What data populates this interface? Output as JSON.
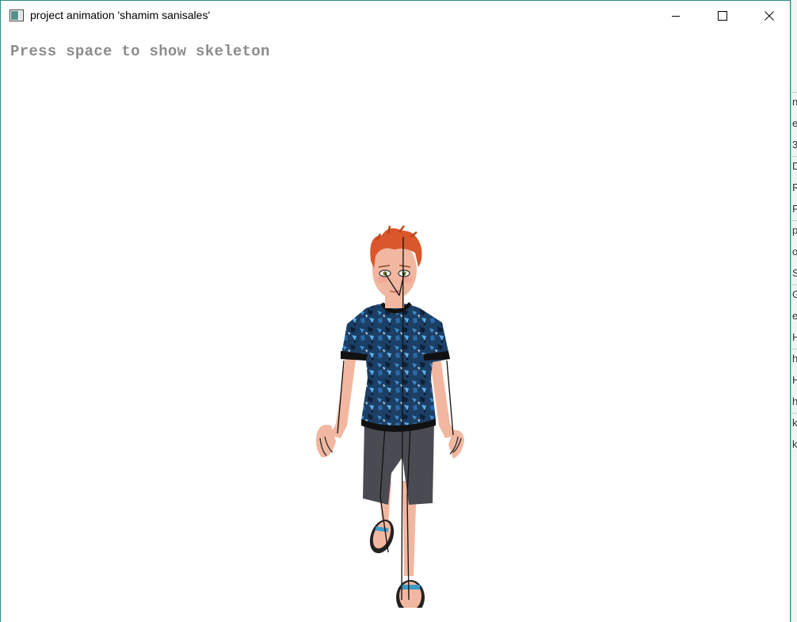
{
  "window": {
    "title": "project animation 'shamim sanisales'",
    "controls": {
      "minimize": "minimize",
      "maximize": "maximize",
      "close": "close"
    }
  },
  "viewport": {
    "hint_text": "Press space to show skeleton",
    "skeleton_visible": true,
    "character": {
      "hair_color": "#d9572a",
      "skin_color": "#f2b7a0",
      "shirt_color": "#1c3f66",
      "shirt_pattern_color": "#3f8fd0",
      "shorts_color": "#4a4a52",
      "sandal_strap_color": "#3a9cc8",
      "skeleton_color": "#111111"
    }
  },
  "background_window": {
    "glyphs": [
      "n",
      "e",
      "3",
      "D",
      "R",
      "P",
      "p",
      "o",
      "S",
      "G",
      "e",
      "H",
      "h",
      "H",
      "h",
      "k",
      "k"
    ]
  }
}
